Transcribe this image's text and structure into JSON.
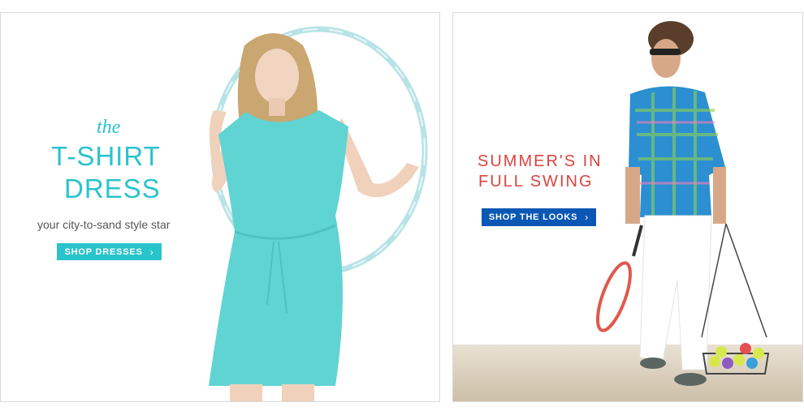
{
  "left_banner": {
    "eyebrow": "the",
    "title_line1": "T-SHIRT",
    "title_line2": "DRESS",
    "subtitle": "your city-to-sand style star",
    "button_label": "SHOP DRESSES",
    "accent": "#29c4cb"
  },
  "right_banner": {
    "title_line1": "SUMMER'S IN",
    "title_line2": "FULL SWING",
    "button_label": "SHOP THE LOOKS",
    "accent": "#d9453f",
    "button_color": "#0a57b4"
  },
  "icons": {
    "chevron": "chevron-right-icon"
  }
}
